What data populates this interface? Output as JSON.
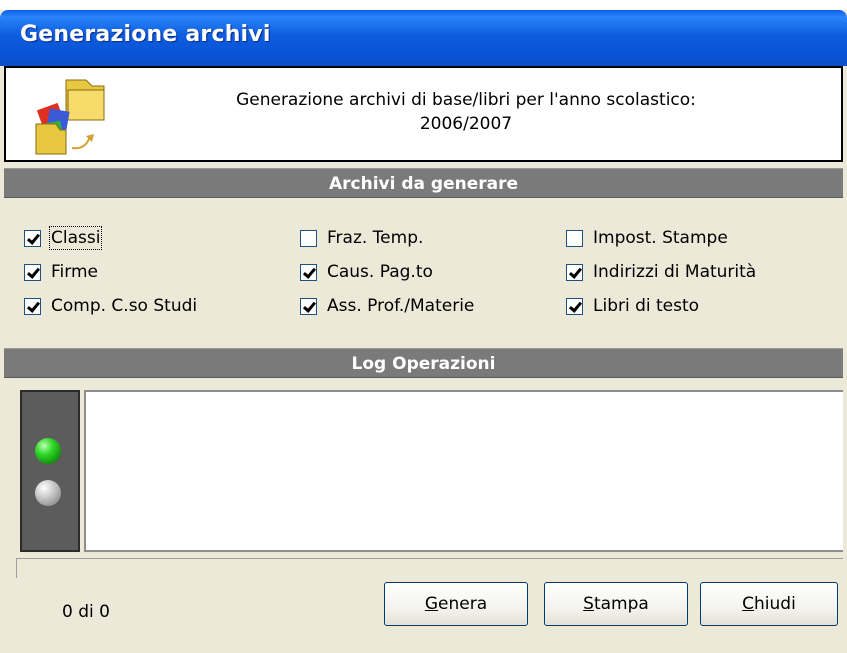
{
  "window": {
    "title": "Generazione archivi"
  },
  "info": {
    "line1": "Generazione archivi di base/libri per l'anno scolastico:",
    "line2": "2006/2007"
  },
  "sections": {
    "archives_header": "Archivi da generare",
    "log_header": "Log Operazioni"
  },
  "checkboxes": [
    {
      "label": "Classi",
      "checked": true
    },
    {
      "label": "Fraz. Temp.",
      "checked": false
    },
    {
      "label": "Impost. Stampe",
      "checked": false
    },
    {
      "label": "Firme",
      "checked": true
    },
    {
      "label": "Caus. Pag.to",
      "checked": true
    },
    {
      "label": "Indirizzi di Maturità",
      "checked": true
    },
    {
      "label": "Comp. C.so Studi",
      "checked": true
    },
    {
      "label": "Ass. Prof./Materie",
      "checked": true
    },
    {
      "label": "Libri di testo",
      "checked": true
    }
  ],
  "status": {
    "counter": "0 di 0"
  },
  "buttons": {
    "genera": {
      "accel": "G",
      "rest": "enera"
    },
    "stampa": {
      "accel": "S",
      "rest": "tampa"
    },
    "chiudi": {
      "accel": "C",
      "rest": "hiudi"
    }
  },
  "colors": {
    "titlebar": "#0a55d8",
    "window_bg": "#ece9d8",
    "section_header": "#7a7a7a",
    "led_on": "#32d82a",
    "led_off": "#c8c8c8"
  },
  "icons": [
    "app-folder-icon",
    "led-green-icon",
    "led-gray-icon"
  ]
}
